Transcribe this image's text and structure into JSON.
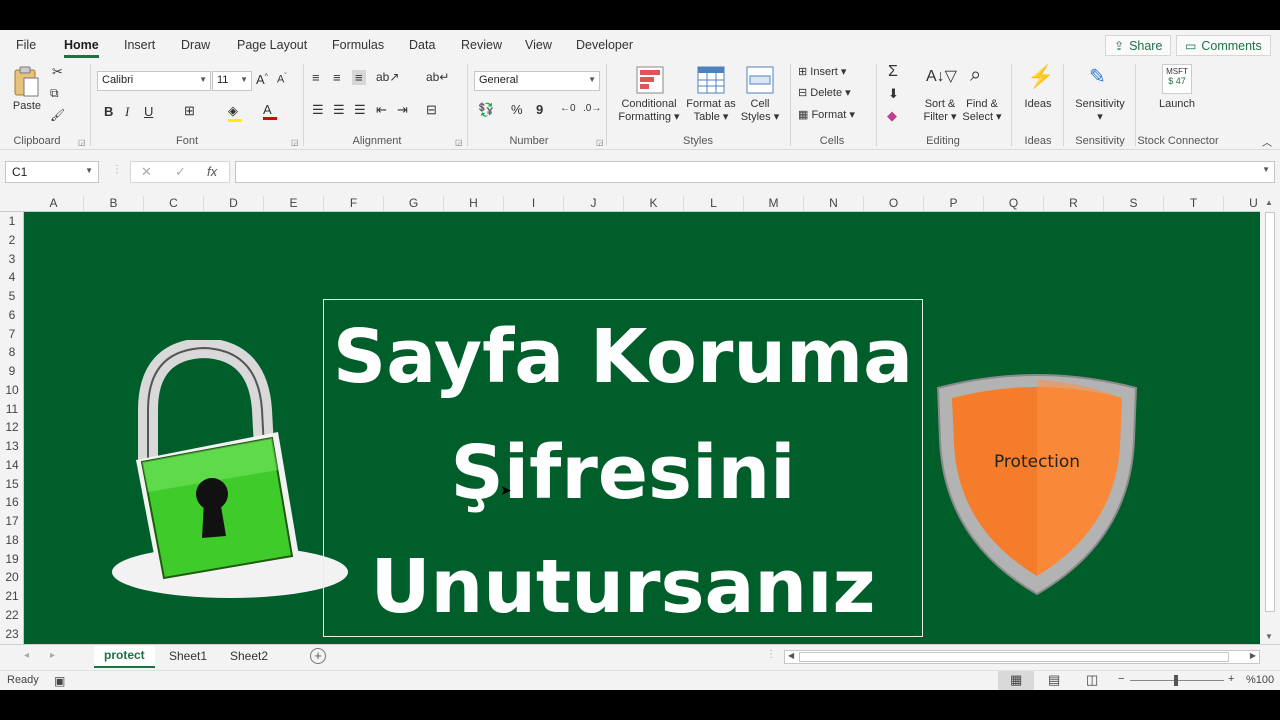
{
  "ribbon_tabs": [
    "File",
    "Home",
    "Insert",
    "Draw",
    "Page Layout",
    "Formulas",
    "Data",
    "Review",
    "View",
    "Developer"
  ],
  "active_tab": "Home",
  "share_label": "Share",
  "comments_label": "Comments",
  "clipboard": {
    "paste": "Paste",
    "group": "Clipboard"
  },
  "font": {
    "name": "Calibri",
    "size": "11",
    "group": "Font",
    "bold": "B",
    "italic": "I",
    "underline": "U"
  },
  "alignment": {
    "group": "Alignment"
  },
  "number": {
    "format": "General",
    "group": "Number",
    "percent": "%"
  },
  "styles": {
    "conditional": [
      "Conditional",
      "Formatting"
    ],
    "format_table": [
      "Format as",
      "Table"
    ],
    "cell_styles": [
      "Cell",
      "Styles"
    ],
    "group": "Styles"
  },
  "cells": {
    "insert": "Insert",
    "delete": "Delete",
    "format": "Format",
    "group": "Cells"
  },
  "editing": {
    "sort": [
      "Sort &",
      "Filter"
    ],
    "find": [
      "Find &",
      "Select"
    ],
    "group": "Editing"
  },
  "ideas": {
    "label": "Ideas",
    "group": "Ideas"
  },
  "sensitivity": {
    "label": "Sensitivity",
    "group": "Sensitivity"
  },
  "stock": {
    "ticker": "MSFT",
    "price": "$ 47",
    "launch": "Launch",
    "group": "Stock Connector"
  },
  "formula_bar": {
    "name_box": "C1",
    "formula": ""
  },
  "columns": [
    "A",
    "B",
    "C",
    "D",
    "E",
    "F",
    "G",
    "H",
    "I",
    "J",
    "K",
    "L",
    "M",
    "N",
    "O",
    "P",
    "Q",
    "R",
    "S",
    "T",
    "U"
  ],
  "rows": [
    "1",
    "2",
    "3",
    "4",
    "5",
    "6",
    "7",
    "8",
    "9",
    "10",
    "11",
    "12",
    "13",
    "14",
    "15",
    "16",
    "17",
    "18",
    "19",
    "20",
    "21",
    "22",
    "23"
  ],
  "banner": {
    "line1": "Sayfa Koruma",
    "line2": "Şifresini",
    "line3": "Unutursanız"
  },
  "shield_text": "Protection",
  "sheets": [
    "protect",
    "Sheet1",
    "Sheet2"
  ],
  "active_sheet": "protect",
  "status": {
    "ready": "Ready",
    "zoom": "%100"
  },
  "colors": {
    "sheet_bg": "#005e2b",
    "accent": "#1e7145",
    "lock_green": "#3fcc2a",
    "shield_orange": "#f47c2a"
  }
}
